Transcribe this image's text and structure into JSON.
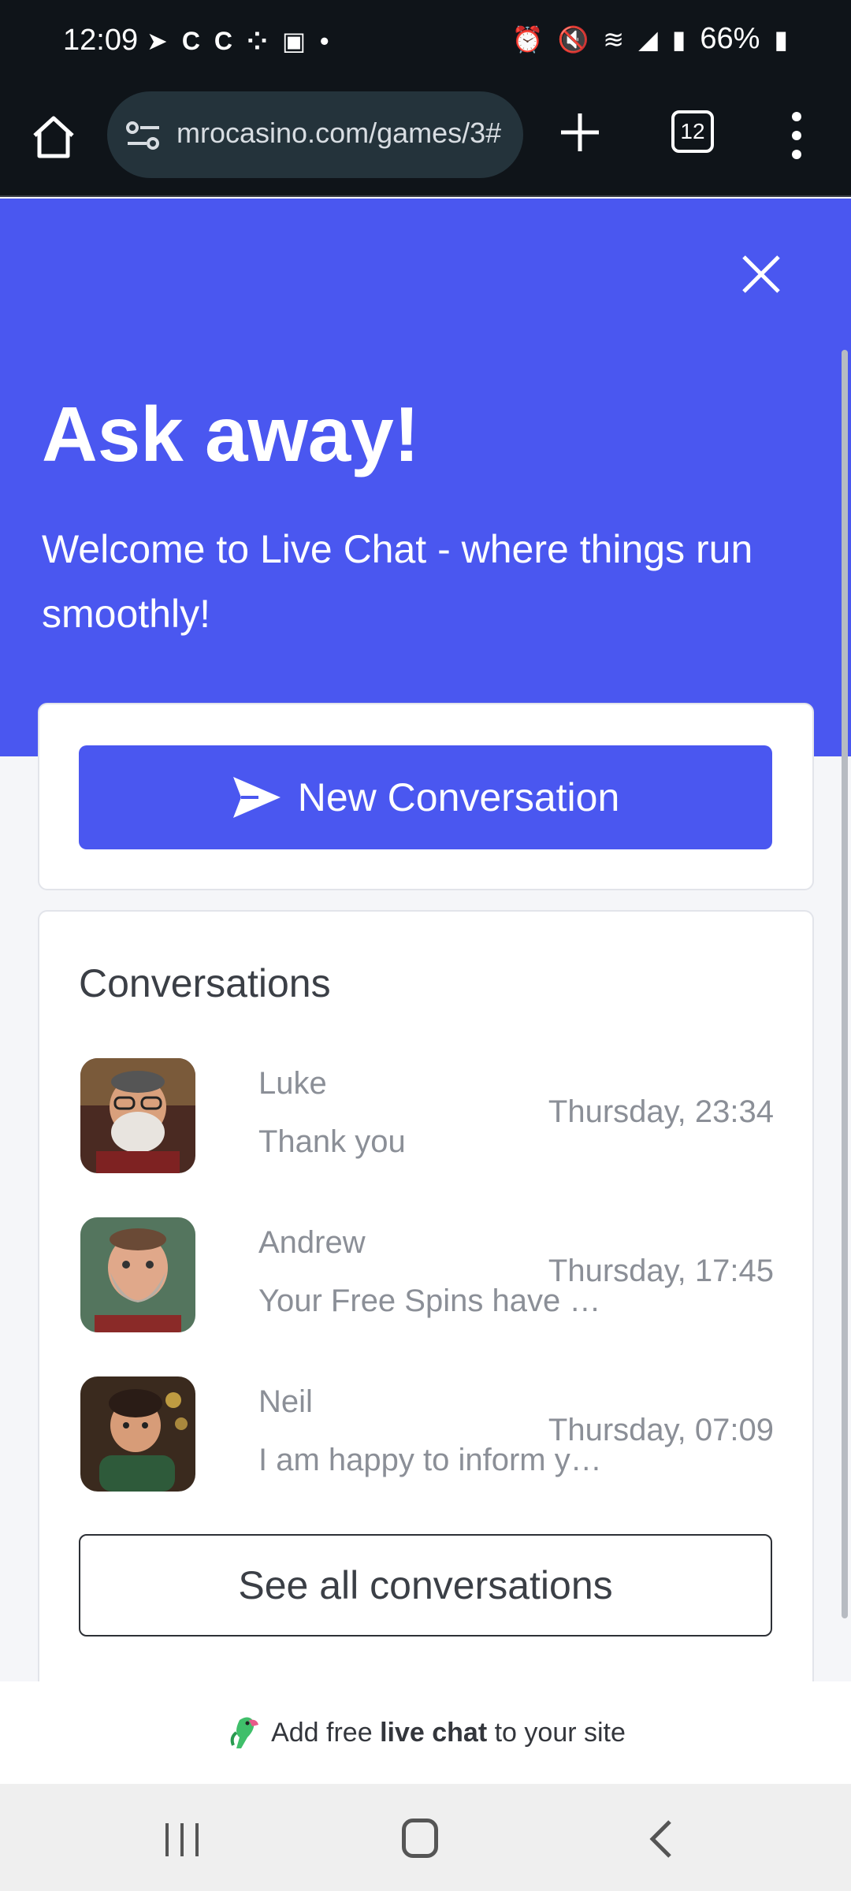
{
  "status_bar": {
    "time": "12:09",
    "left_icons": [
      "telegram-icon",
      "c-icon",
      "c-icon",
      "app-icon",
      "voicemail-icon",
      "dot-icon"
    ],
    "right_icons": [
      "alarm-icon",
      "mute-icon",
      "wifi-icon",
      "signal-icon",
      "signal-icon",
      "battery-icon"
    ],
    "battery": "66%"
  },
  "browser": {
    "url": "mrocasino.com/games/3#",
    "tab_count": "12"
  },
  "chat": {
    "title": "Ask away!",
    "subtitle": "Welcome to Live Chat - where things run smoothly!",
    "new_conversation_label": "New Conversation",
    "conversations_heading": "Conversations",
    "conversations": [
      {
        "name": "Luke",
        "message": "Thank you",
        "time": "Thursday, 23:34"
      },
      {
        "name": "Andrew",
        "message": "Your Free Spins have …",
        "time": "Thursday, 17:45"
      },
      {
        "name": "Neil",
        "message": "I am happy to inform y…",
        "time": "Thursday, 07:09"
      }
    ],
    "see_all_label": "See all conversations",
    "footer": {
      "prefix": "Add free ",
      "bold": "live chat",
      "suffix": " to your site"
    }
  },
  "colors": {
    "brand": "#4a57f0",
    "status_bar": "#0f1419",
    "muted_text": "#8b8f97"
  }
}
